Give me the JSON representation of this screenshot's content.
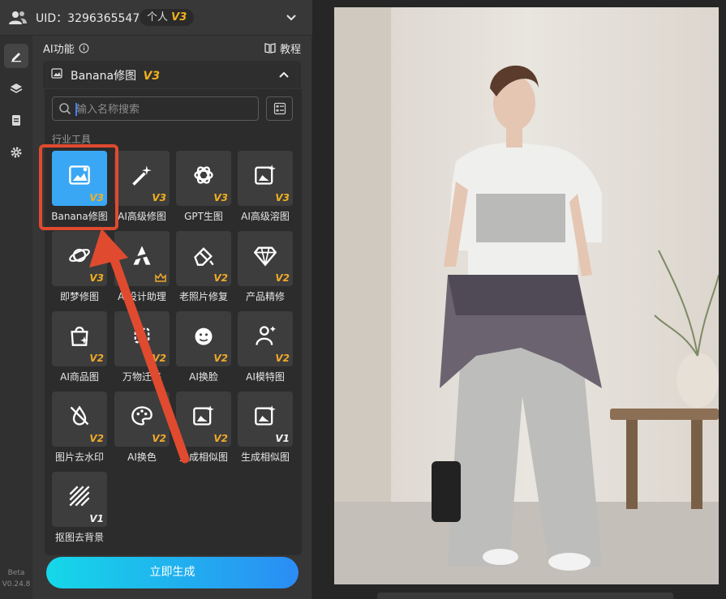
{
  "header": {
    "uid_text": "UID：3296365547",
    "tag_label": "个人",
    "tag_version": "V3"
  },
  "rail": {
    "items": [
      {
        "icon": "edit-icon",
        "active": true
      },
      {
        "icon": "layers-icon",
        "active": false
      },
      {
        "icon": "clipboard-icon",
        "active": false
      },
      {
        "icon": "gear-icon",
        "active": false
      }
    ],
    "beta_label": "Beta",
    "version": "V0.24.8"
  },
  "panel": {
    "ai_title": "AI功能",
    "tutorial_label": "教程",
    "section_title": "Banana修图",
    "section_version": "V3"
  },
  "popup": {
    "search_placeholder": "输入名称搜索",
    "category_label": "行业工具",
    "tools": [
      {
        "label": "Banana修图",
        "version": "V3",
        "icon": "image-edit-icon",
        "selected": true
      },
      {
        "label": "AI高级修图",
        "version": "V3",
        "icon": "magic-wand-icon",
        "selected": false
      },
      {
        "label": "GPT生图",
        "version": "V3",
        "icon": "gpt-logo-icon",
        "selected": false
      },
      {
        "label": "AI高级溶图",
        "version": "V3",
        "icon": "image-sparkle-icon",
        "selected": false
      },
      {
        "label": "即梦修图",
        "version": "V3",
        "icon": "planet-icon",
        "selected": false
      },
      {
        "label": "AI设计助理",
        "version": "",
        "icon": "ai-logo-icon",
        "selected": false
      },
      {
        "label": "老照片修复",
        "version": "V2",
        "icon": "eraser-icon",
        "selected": false
      },
      {
        "label": "产品精修",
        "version": "V2",
        "icon": "diamond-icon",
        "selected": false
      },
      {
        "label": "AI商品图",
        "version": "V2",
        "icon": "shopping-bag-icon",
        "selected": false
      },
      {
        "label": "万物迁移",
        "version": "V2",
        "icon": "transfer-icon",
        "selected": false
      },
      {
        "label": "AI换脸",
        "version": "V2",
        "icon": "face-swap-icon",
        "selected": false
      },
      {
        "label": "AI模特图",
        "version": "V2",
        "icon": "model-person-icon",
        "selected": false
      },
      {
        "label": "图片去水印",
        "version": "V2",
        "icon": "no-watermark-icon",
        "selected": false
      },
      {
        "label": "AI换色",
        "version": "V2",
        "icon": "palette-icon",
        "selected": false
      },
      {
        "label": "生成相似图",
        "version": "V2",
        "icon": "similar-image-icon",
        "selected": false
      },
      {
        "label": "生成相似图",
        "version": "V1",
        "icon": "similar-image-icon",
        "selected": false
      },
      {
        "label": "抠图去背景",
        "version": "V1",
        "icon": "cutout-icon",
        "selected": false
      }
    ]
  },
  "generate_button": "立即生成",
  "colors": {
    "accent_blue": "#3aa7f5",
    "version_gold": "#f2b01e",
    "highlight_red": "#e04a2f"
  }
}
